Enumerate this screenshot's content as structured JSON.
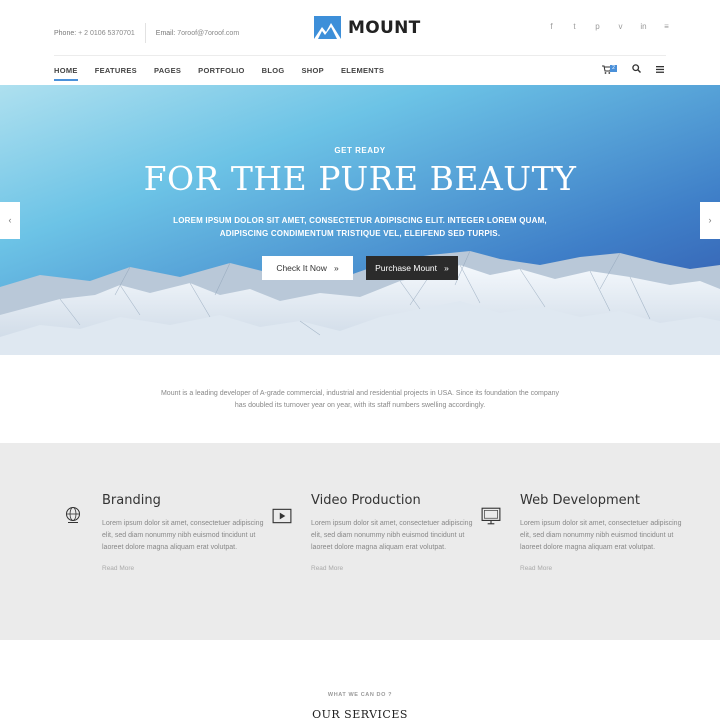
{
  "contact": {
    "phone_label": "Phone:",
    "phone": "+ 2 0106 5370701",
    "email_label": "Email:",
    "email": "7oroof@7oroof.com"
  },
  "brand": {
    "name": "MOUNT",
    "accent": "#4a90d9"
  },
  "socials": [
    {
      "icon": "facebook-icon",
      "glyph": "f"
    },
    {
      "icon": "twitter-icon",
      "glyph": "t"
    },
    {
      "icon": "pinterest-icon",
      "glyph": "p"
    },
    {
      "icon": "vimeo-icon",
      "glyph": "v"
    },
    {
      "icon": "linkedin-icon",
      "glyph": "in"
    },
    {
      "icon": "rss-icon",
      "glyph": "≡"
    }
  ],
  "nav": {
    "items": [
      "HOME",
      "FEATURES",
      "PAGES",
      "PORTFOLIO",
      "BLOG",
      "SHOP",
      "ELEMENTS"
    ],
    "active": "HOME",
    "cart_count": "2"
  },
  "hero": {
    "kicker": "GET READY",
    "title": "FOR THE PURE BEAUTY",
    "subtitle": "LOREM IPSUM DOLOR SIT AMET, CONSECTETUR ADIPISCING ELIT. INTEGER LOREM QUAM, ADIPISCING CONDIMENTUM TRISTIQUE VEL, ELEIFEND SED TURPIS.",
    "primary_button": "Check It Now",
    "secondary_button": "Purchase Mount"
  },
  "intro": "Mount is a leading developer of A-grade commercial, industrial and residential projects in USA. Since its foundation the company has doubled its turnover year on year, with its staff numbers swelling accordingly.",
  "features": [
    {
      "icon": "globe-icon",
      "title": "Branding",
      "text": "Lorem ipsum dolor sit amet, consectetuer adipiscing elit, sed diam nonummy nibh euismod tincidunt ut laoreet dolore magna aliquam erat volutpat.",
      "link": "Read More"
    },
    {
      "icon": "video-play-icon",
      "title": "Video Production",
      "text": "Lorem ipsum dolor sit amet, consectetuer adipiscing elit, sed diam nonummy nibh euismod tincidunt ut laoreet dolore magna aliquam erat volutpat.",
      "link": "Read More"
    },
    {
      "icon": "monitor-icon",
      "title": "Web Development",
      "text": "Lorem ipsum dolor sit amet, consectetuer adipiscing elit, sed diam nonummy nibh euismod tincidunt ut laoreet dolore magna aliquam erat volutpat.",
      "link": "Read More"
    }
  ],
  "services": {
    "kicker": "WHAT WE CAN DO ?",
    "title": "OUR SERVICES"
  }
}
